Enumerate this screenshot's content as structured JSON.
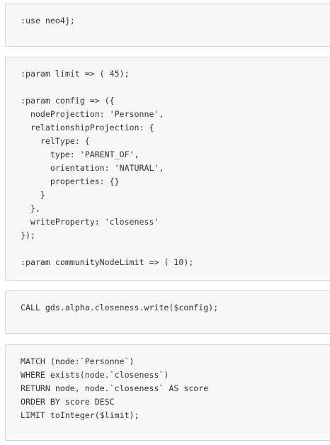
{
  "blocks": [
    {
      "code": ":use neo4j;"
    },
    {
      "code": ":param limit => ( 45);\n\n:param config => ({\n  nodeProjection: 'Personne',\n  relationshipProjection: {\n    relType: {\n      type: 'PARENT_OF',\n      orientation: 'NATURAL',\n      properties: {}\n    }\n  },\n  writeProperty: 'closeness'\n});\n\n:param communityNodeLimit => ( 10);"
    },
    {
      "code": "CALL gds.alpha.closeness.write($config);"
    },
    {
      "code": "MATCH (node:`Personne`)\nWHERE exists(node.`closeness`)\nRETURN node, node.`closeness` AS score\nORDER BY score DESC\nLIMIT toInteger($limit);"
    }
  ]
}
